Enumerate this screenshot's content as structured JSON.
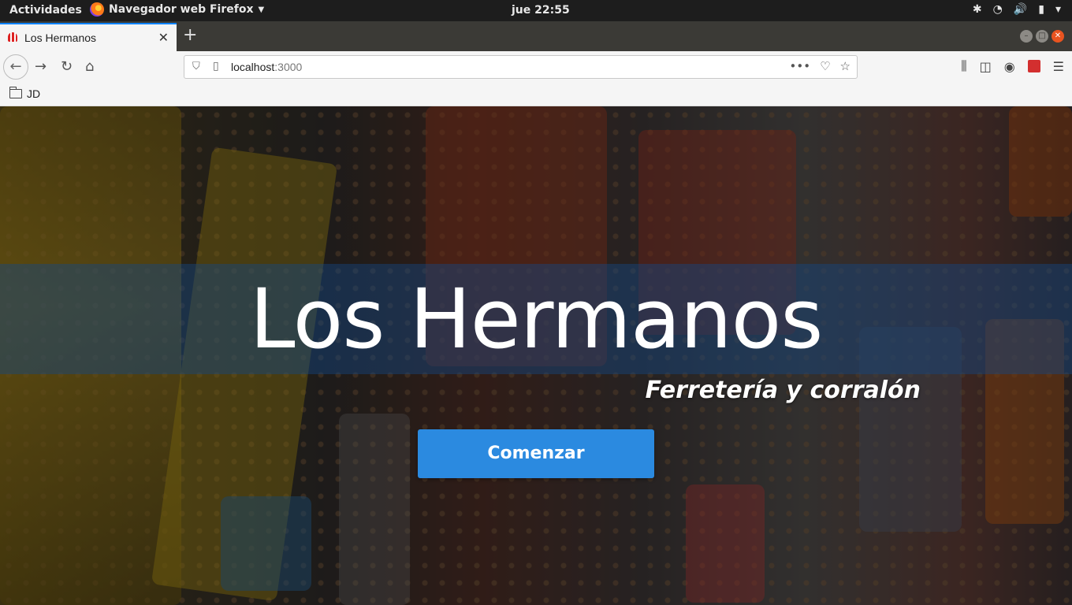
{
  "gnome": {
    "activities": "Actividades",
    "app_menu": "Navegador web Firefox",
    "clock": "jue 22:55"
  },
  "browser": {
    "tab_title": "Los Hermanos",
    "url_host": "localhost",
    "url_port": ":3000",
    "bookmark_folder": "JD"
  },
  "page": {
    "title": "Los Hermanos",
    "subtitle": "Ferretería y corralón",
    "cta_label": "Comenzar"
  },
  "colors": {
    "cta": "#2b8ae0",
    "tab_accent": "#0a84ff",
    "gnome_bar": "#1d1d1d"
  }
}
